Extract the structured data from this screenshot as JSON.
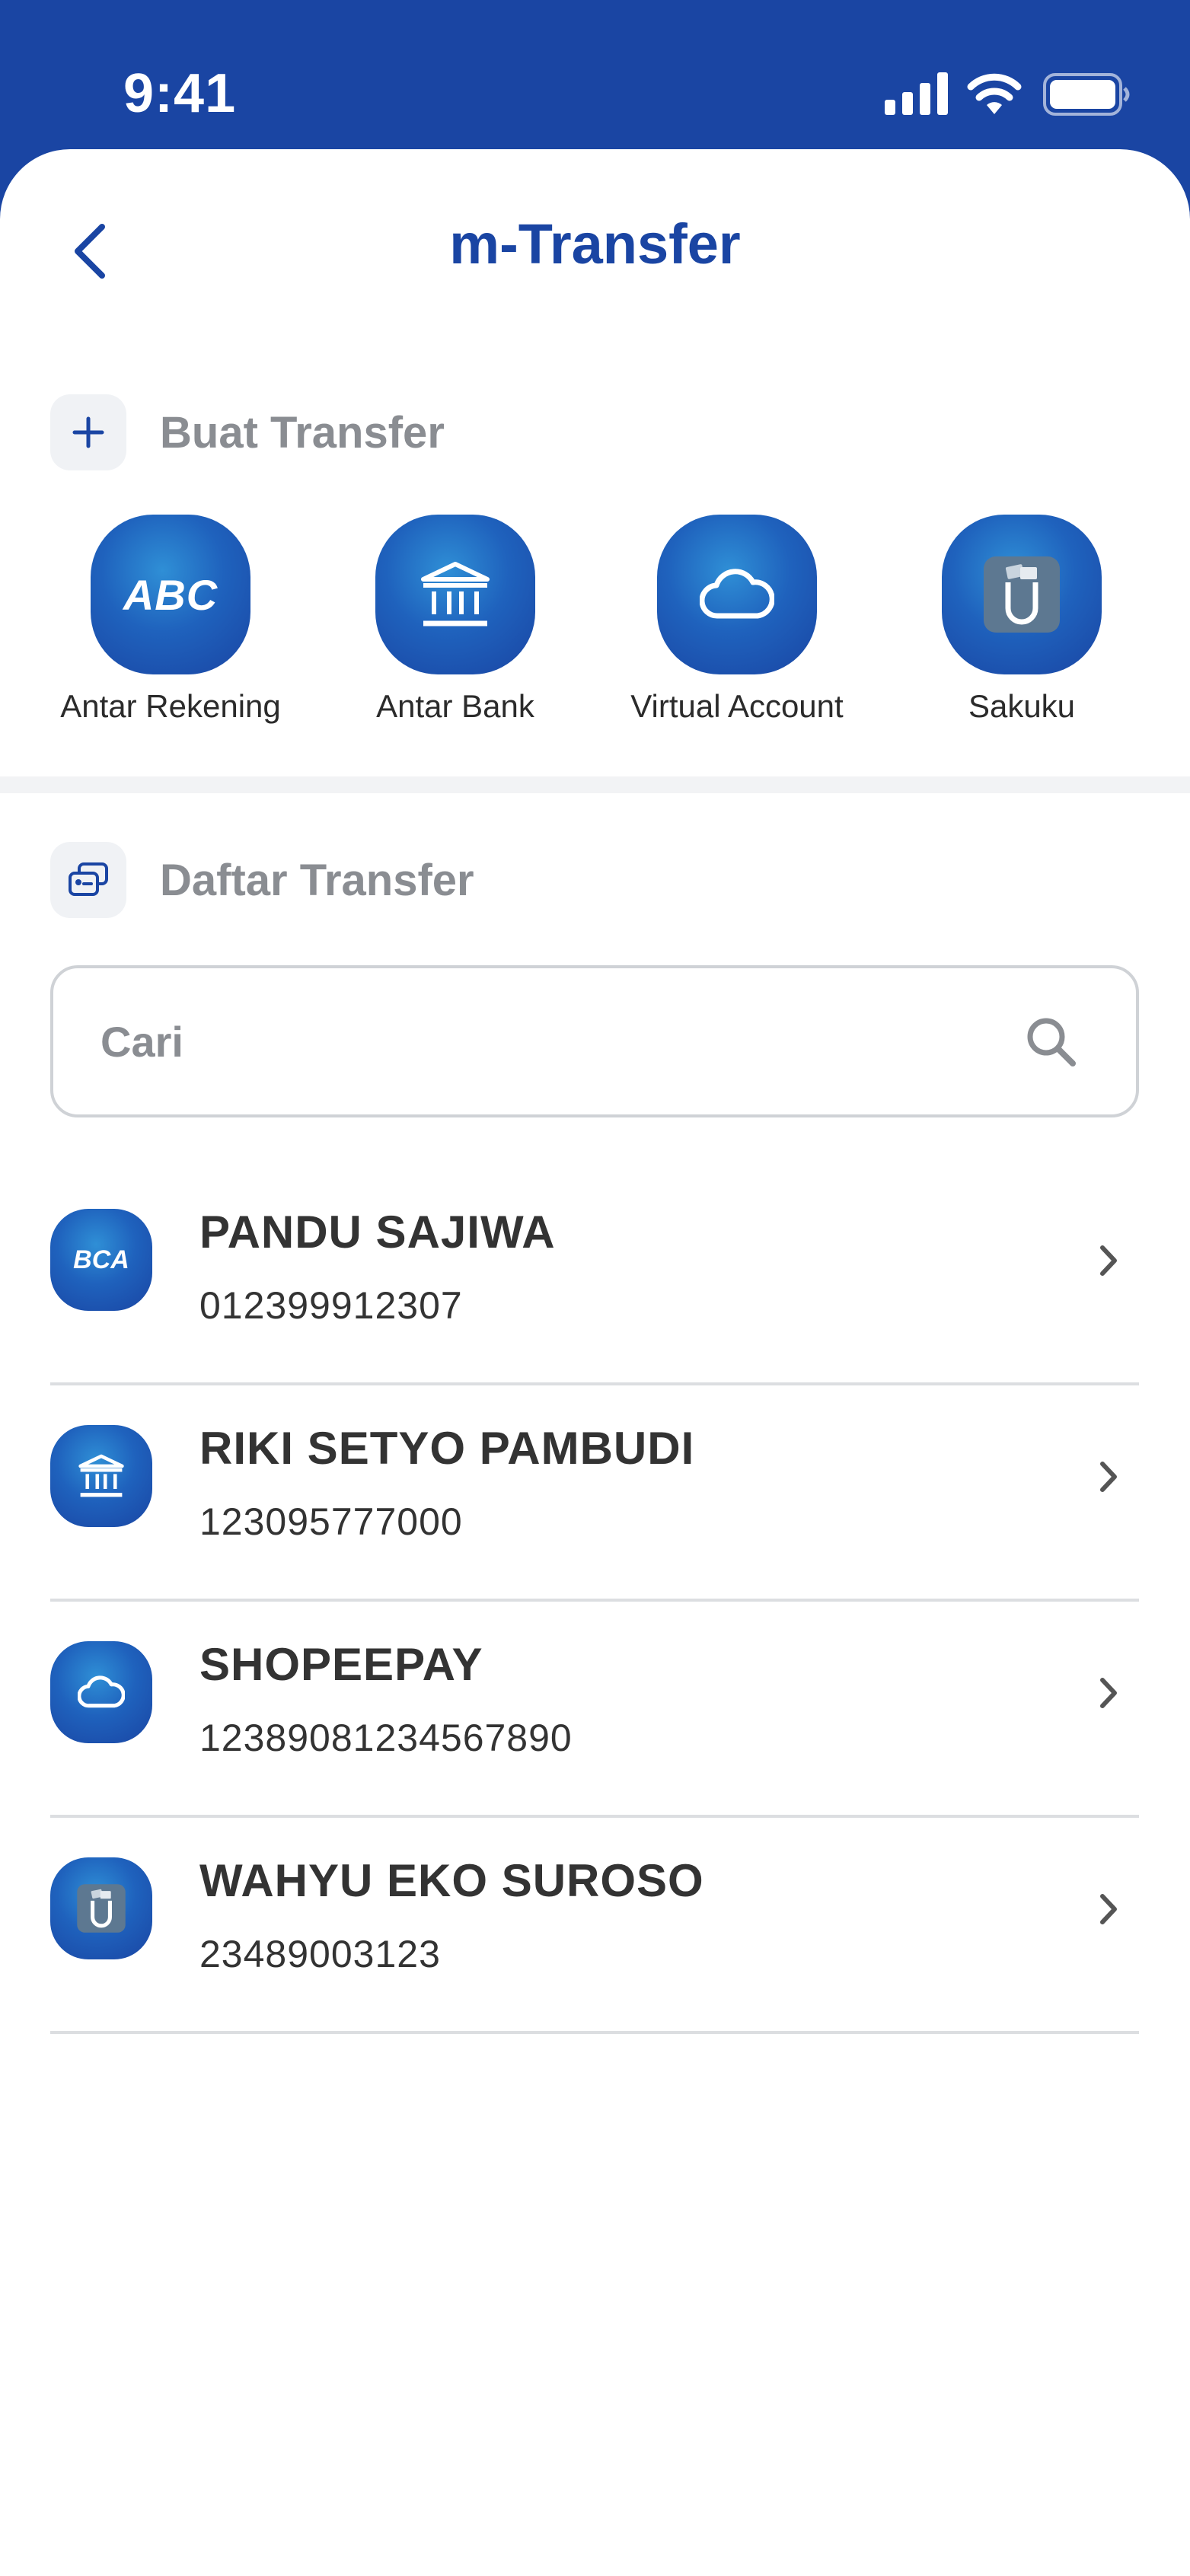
{
  "status_bar": {
    "time": "9:41"
  },
  "header": {
    "title": "m-Transfer"
  },
  "create_section": {
    "label": "Buat Transfer",
    "items": [
      {
        "label": "Antar Rekening",
        "icon": "abc-icon",
        "icon_text": "ABC"
      },
      {
        "label": "Antar Bank",
        "icon": "bank-icon"
      },
      {
        "label": "Virtual Account",
        "icon": "cloud-icon"
      },
      {
        "label": "Sakuku",
        "icon": "sakuku-icon"
      }
    ]
  },
  "list_section": {
    "label": "Daftar Transfer",
    "search": {
      "placeholder": "Cari",
      "value": ""
    },
    "items": [
      {
        "name": "PANDU SAJIWA",
        "account": "012399912307",
        "icon": "bca-icon",
        "icon_text": "BCA"
      },
      {
        "name": "RIKI SETYO PAMBUDI",
        "account": "123095777000",
        "icon": "bank-icon"
      },
      {
        "name": "SHOPEEPAY",
        "account": "12389081234567890",
        "icon": "cloud-icon"
      },
      {
        "name": "WAHYU EKO SUROSO",
        "account": "23489003123",
        "icon": "sakuku-icon"
      }
    ]
  },
  "colors": {
    "brand": "#1a45a3",
    "accent_light": "#2f8fd6",
    "muted_text": "#8a8d92",
    "divider": "#dcdee1"
  }
}
